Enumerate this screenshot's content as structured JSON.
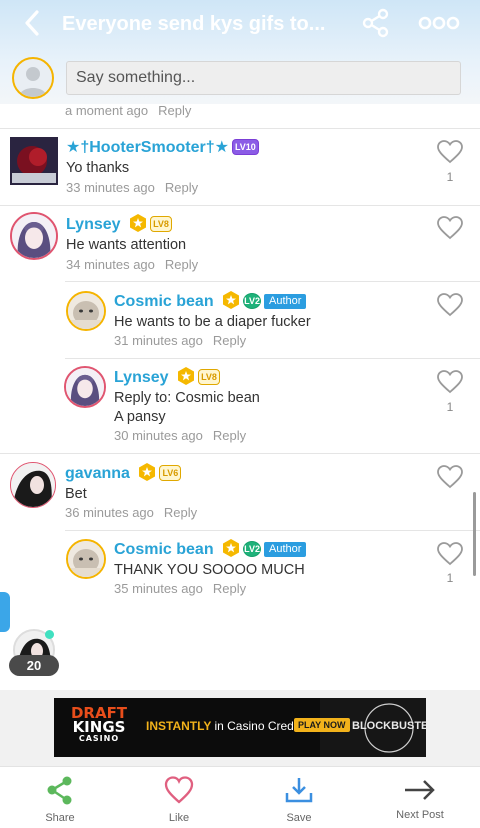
{
  "header": {
    "title": "Everyone send kys gifs to...",
    "input_placeholder": "Say something..."
  },
  "top_meta": {
    "time": "a moment ago",
    "reply": "Reply"
  },
  "comments": [
    {
      "name": "★†HooterSmooter†★",
      "level": "LV10",
      "text": "Yo thanks",
      "time": "33 minutes ago",
      "reply": "Reply",
      "likes": "1"
    },
    {
      "name": "Lynsey",
      "level": "LV8",
      "text": "He wants attention",
      "time": "34 minutes ago",
      "reply": "Reply",
      "likes": ""
    },
    {
      "name": "Cosmic bean",
      "level": "LV2",
      "author": "Author",
      "text": "He wants to be a diaper fucker",
      "time": "31 minutes ago",
      "reply": "Reply",
      "likes": ""
    },
    {
      "name": "Lynsey",
      "level": "LV8",
      "text": "Reply to: Cosmic bean",
      "text2": "A pansy",
      "time": "30 minutes ago",
      "reply": "Reply",
      "likes": "1"
    },
    {
      "name": "gavanna",
      "level": "LV6",
      "text": "Bet",
      "time": "36 minutes ago",
      "reply": "Reply",
      "likes": ""
    },
    {
      "name": "Cosmic bean",
      "level": "LV2",
      "author": "Author",
      "text": "THANK YOU SOOOO MUCH",
      "time": "35 minutes ago",
      "reply": "Reply",
      "likes": "1"
    }
  ],
  "floating": {
    "count": "20"
  },
  "ad": {
    "brand_line1": "DRAFT",
    "brand_line2": "KINGS",
    "brand_line3": "CASINO",
    "tagline_1": "INSTANTLY",
    "tagline_2": "in Casino Credits",
    "cta": "PLAY NOW",
    "right": "BLOCKBUSTER"
  },
  "bottom_bar": {
    "share": "Share",
    "like": "Like",
    "save": "Save",
    "next": "Next Post"
  },
  "colors": {
    "name_blue": "#29a3d6",
    "share_green": "#5cb85c",
    "like_red": "#e06080",
    "save_blue": "#3b8fe0"
  }
}
